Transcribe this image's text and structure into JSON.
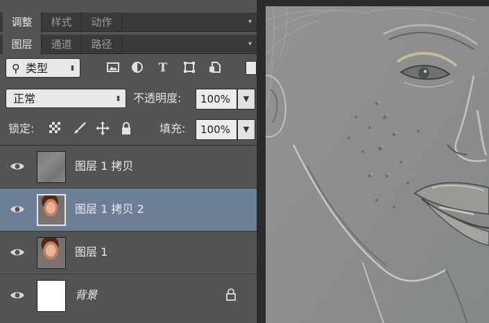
{
  "tabs_top": [
    "调整",
    "样式",
    "动作"
  ],
  "tabs_layers": [
    "图层",
    "通道",
    "路径"
  ],
  "filter": {
    "kind_label": "类型",
    "icons": [
      "image-filter-icon",
      "adjustment-filter-icon",
      "type-filter-icon",
      "shape-filter-icon",
      "smart-object-filter-icon"
    ]
  },
  "blend": {
    "mode": "正常",
    "opacity_label": "不透明度:",
    "opacity_value": "100%"
  },
  "lock": {
    "label": "锁定:",
    "fill_label": "填充:",
    "fill_value": "100%"
  },
  "layers": [
    {
      "name": "图层 1 拷贝",
      "thumbnail": "gray",
      "visible": true,
      "selected": false
    },
    {
      "name": "图层 1 拷贝 2",
      "thumbnail": "photo",
      "visible": true,
      "selected": true
    },
    {
      "name": "图层 1",
      "thumbnail": "photo",
      "visible": true,
      "selected": false
    },
    {
      "name": "背景",
      "thumbnail": "white",
      "visible": true,
      "selected": false,
      "locked": true
    }
  ],
  "colors": {
    "panel_bg": "#535353",
    "selected_row": "#6d7e97",
    "canvas_gray": "#8a8d8a"
  }
}
